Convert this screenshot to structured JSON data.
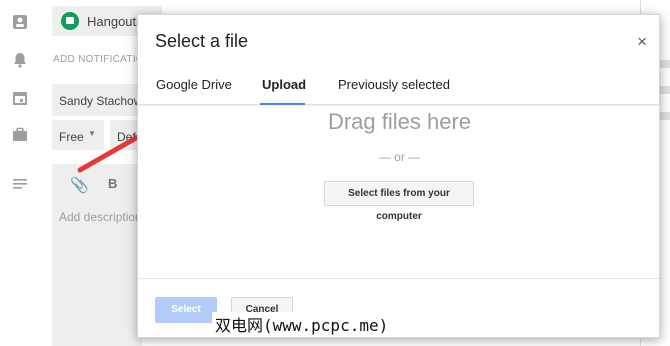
{
  "background": {
    "sidebar_icons": [
      "contacts-icon",
      "bell-icon",
      "calendar-icon",
      "briefcase-icon",
      "notes-icon"
    ],
    "hangouts_label": "Hangouts",
    "notifications_label": "ADD NOTIFICATION",
    "guest_name": "Sandy Stachowi",
    "availability": "Free",
    "visibility": "Def",
    "description_placeholder": "Add description",
    "bold_label": "B"
  },
  "dialog": {
    "title": "Select a file",
    "close_symbol": "×",
    "tabs": [
      {
        "label": "Google Drive",
        "active": false
      },
      {
        "label": "Upload",
        "active": true
      },
      {
        "label": "Previously selected",
        "active": false
      }
    ],
    "drag_text": "Drag files here",
    "or_text": "— or —",
    "select_files_label": "Select files from your computer",
    "select_label": "Select",
    "cancel_label": "Cancel"
  },
  "annotation": {
    "arrow_color": "#e53935"
  },
  "watermark": "双电网(www.pcpc.me)",
  "colors": {
    "accent": "#4285f4",
    "hangouts_green": "#0f9d58",
    "disabled_button": "#b3cdf8"
  }
}
